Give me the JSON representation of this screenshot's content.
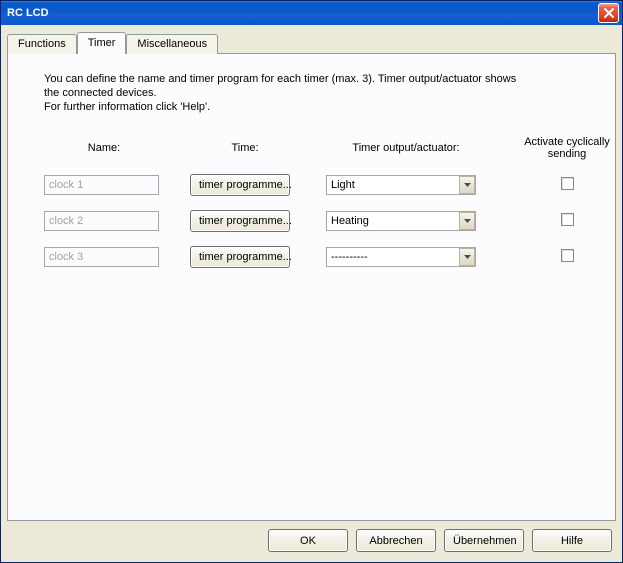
{
  "window": {
    "title": "RC LCD"
  },
  "tabs": {
    "functions": "Functions",
    "timer": "Timer",
    "misc": "Miscellaneous",
    "active": "timer"
  },
  "desc": {
    "line1": "You can define the name and timer program for each timer (max. 3). Timer output/actuator shows",
    "line2": "the connected devices.",
    "line3": "For further information click 'Help'."
  },
  "headers": {
    "name": "Name:",
    "time": "Time:",
    "output": "Timer output/actuator:",
    "activate_line1": "Activate cyclically",
    "activate_line2": "sending"
  },
  "rows": [
    {
      "name": "clock 1",
      "time_btn": "timer programme...",
      "output": "Light",
      "checked": false
    },
    {
      "name": "clock 2",
      "time_btn": "timer programme...",
      "output": "Heating",
      "checked": false
    },
    {
      "name": "clock 3",
      "time_btn": "timer programme...",
      "output": "----------",
      "checked": false
    }
  ],
  "buttons": {
    "ok": "OK",
    "cancel": "Abbrechen",
    "apply": "Übernehmen",
    "help": "Hilfe"
  }
}
